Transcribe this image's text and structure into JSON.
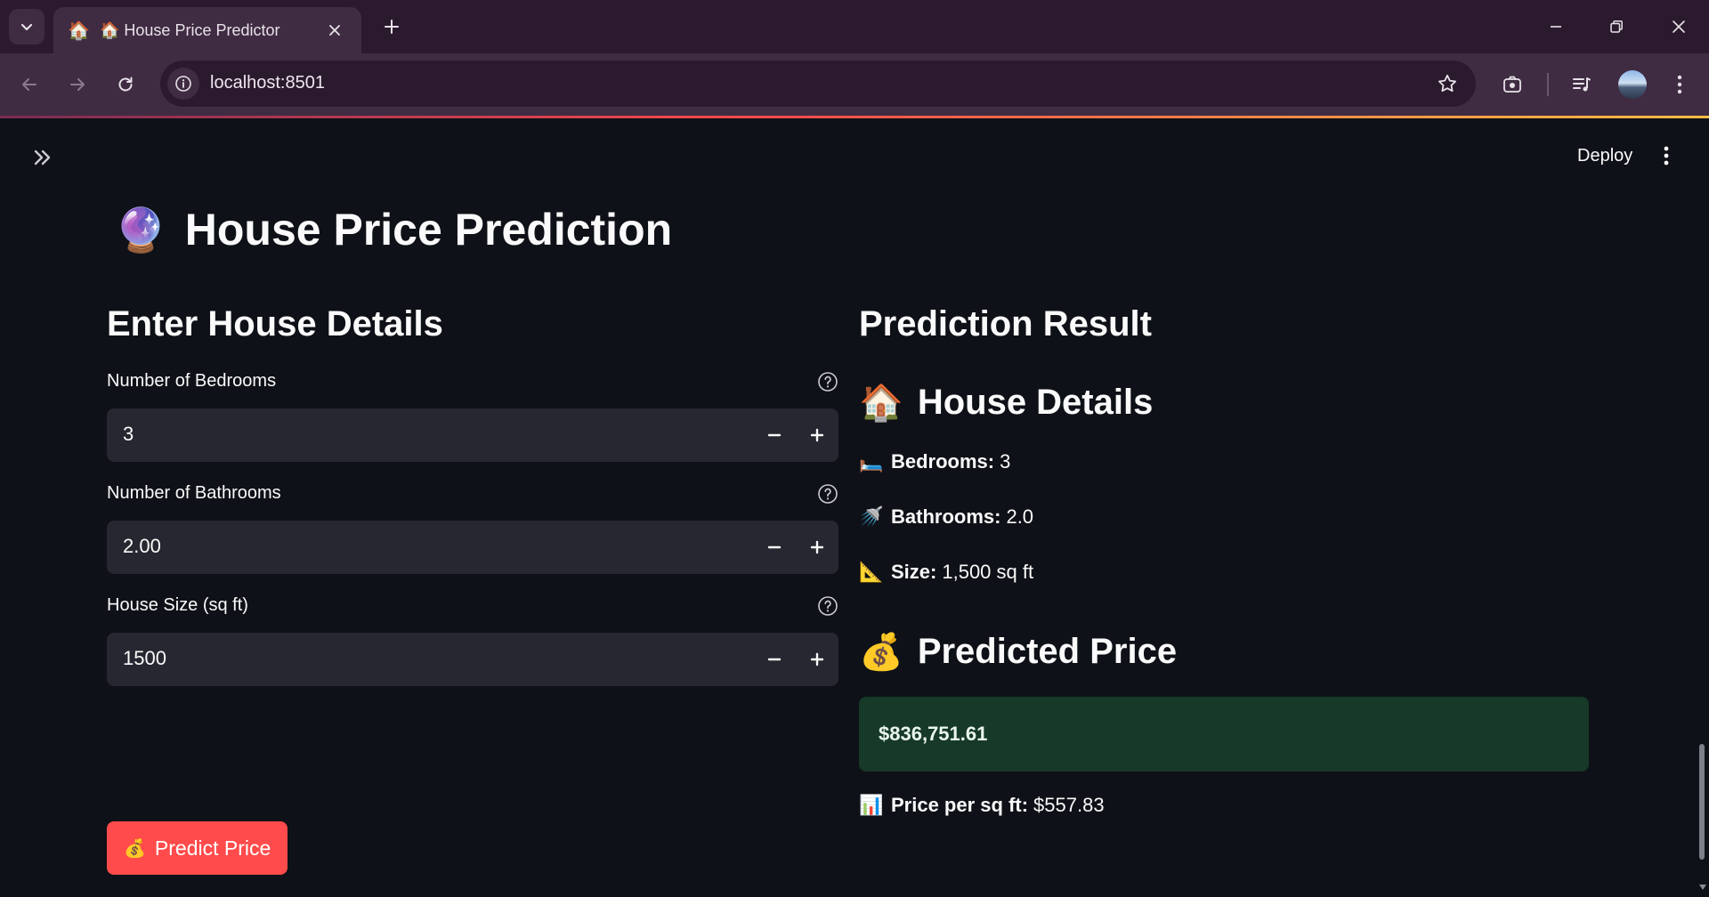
{
  "browser": {
    "tab": {
      "favicon": "🏠",
      "title": "🏠 House Price Predictor"
    },
    "url": "localhost:8501"
  },
  "app": {
    "header": {
      "deploy_label": "Deploy"
    },
    "title": {
      "emoji": "🔮",
      "text": "House Price Prediction"
    },
    "input_section": {
      "heading": "Enter House Details",
      "fields": [
        {
          "label": "Number of Bedrooms",
          "value": "3"
        },
        {
          "label": "Number of Bathrooms",
          "value": "2.00"
        },
        {
          "label": "House Size (sq ft)",
          "value": "1500"
        }
      ],
      "predict_button": {
        "emoji": "💰",
        "label": "Predict Price"
      }
    },
    "result_section": {
      "heading": "Prediction Result",
      "details_heading": {
        "emoji": "🏠",
        "text": "House Details"
      },
      "details": [
        {
          "emoji": "🛏️",
          "label": "Bedrooms:",
          "value": "3"
        },
        {
          "emoji": "🚿",
          "label": "Bathrooms:",
          "value": "2.0"
        },
        {
          "emoji": "📐",
          "label": "Size:",
          "value": "1,500 sq ft"
        }
      ],
      "price_heading": {
        "emoji": "💰",
        "text": "Predicted Price"
      },
      "predicted_price": "$836,751.61",
      "per_sqft": {
        "emoji": "📊",
        "label": "Price per sq ft:",
        "value": "$557.83"
      }
    }
  },
  "colors": {
    "background": "#0e1117",
    "input_bg": "#262730",
    "primary": "#ff4b4b",
    "success_bg": "#173928",
    "chrome_dark": "#2b1a2d",
    "chrome_light": "#3f2b42"
  },
  "icons": {
    "tab_search": "chevron-down-icon",
    "tab_close": "close-icon",
    "new_tab": "plus-icon",
    "back": "arrow-left-icon",
    "forward": "arrow-right-icon",
    "reload": "reload-icon",
    "site_info": "info-icon",
    "bookmark": "star-icon",
    "sidebar_toggle": "double-chevron-right-icon",
    "menu": "kebab-menu-icon",
    "help": "question-circle-icon",
    "minus": "minus-icon",
    "plus": "plus-icon"
  }
}
